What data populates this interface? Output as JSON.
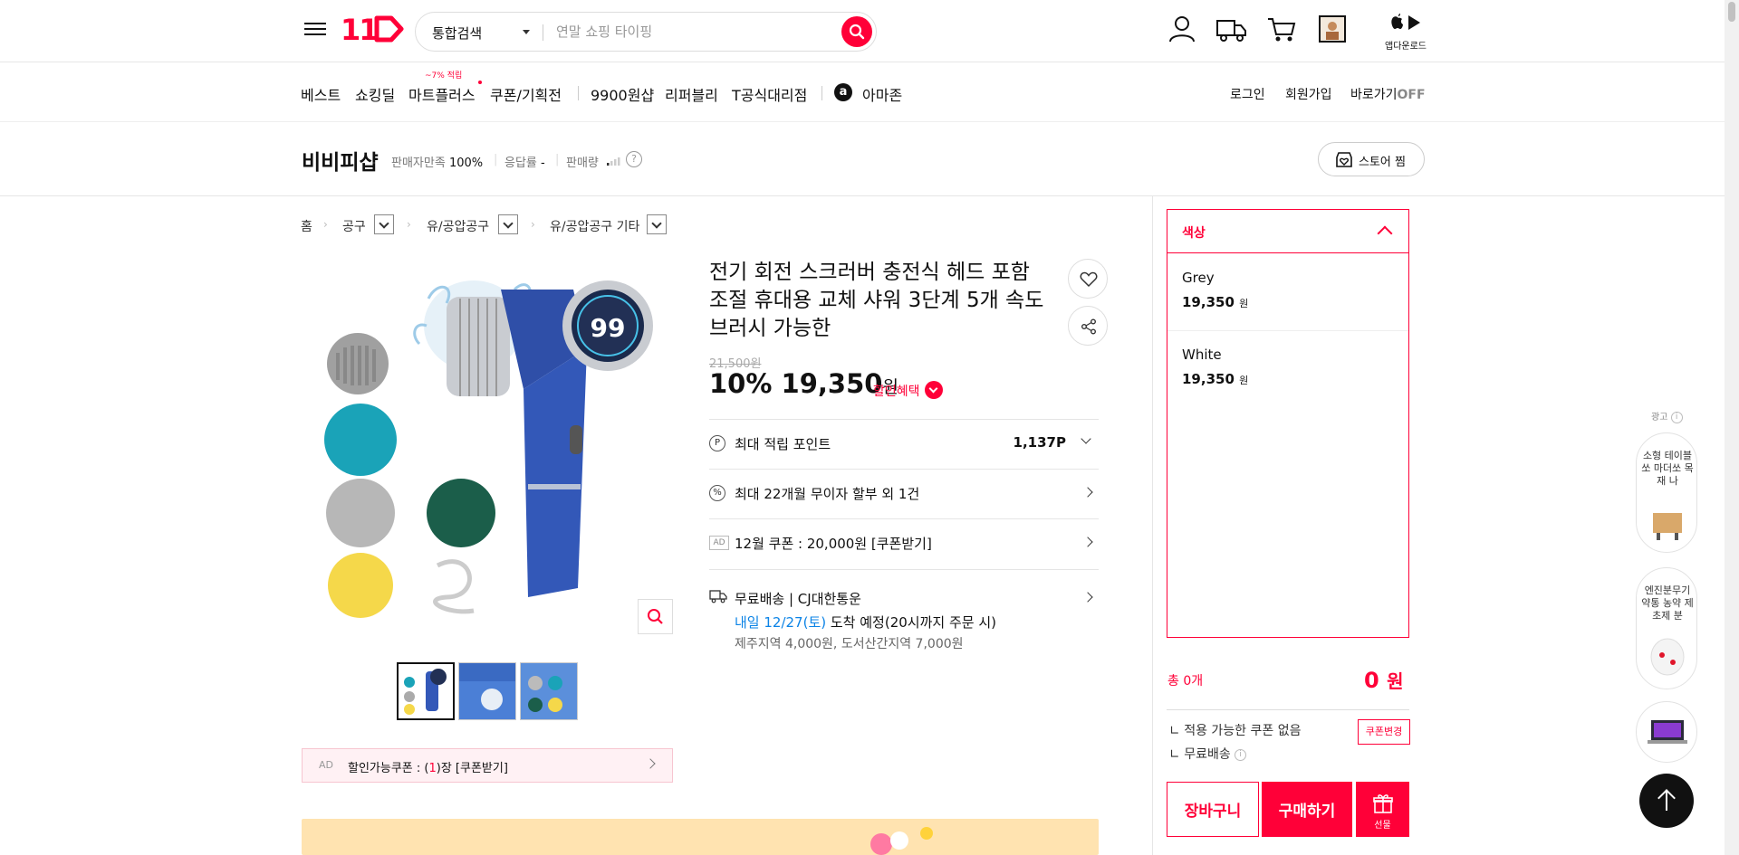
{
  "header": {
    "logo": "11",
    "search_scope": "통합검색",
    "search_placeholder": "연말 쇼핑 타이핑",
    "app_download": "앱다운로드"
  },
  "gnb": {
    "items": [
      "베스트",
      "쇼킹딜",
      "마트플러스",
      "쿠폰/기획전",
      "9900원샵",
      "리퍼블리",
      "T공식대리점",
      "아마존"
    ],
    "mart_badge": "~7% 적립",
    "util": {
      "login": "로그인",
      "join": "회원가입",
      "shortcut": "바로가기",
      "off": "OFF"
    }
  },
  "seller": {
    "name": "비비피샵",
    "satisfaction_label": "판매자만족",
    "satisfaction_value": "100%",
    "response_label": "응답률",
    "response_value": "-",
    "sales_label": "판매량",
    "store_button": "스토어 찜"
  },
  "breadcrumb": [
    "홈",
    "공구",
    "유/공압공구",
    "유/공압공구 기타"
  ],
  "product": {
    "title": "전기 회전 스크러버 충전식 헤드 포함 조절 휴대용 교체 샤워 3단계 5개 속도 브러시 가능한",
    "original_price": "21,500원",
    "discount": "10%",
    "price": "19,350",
    "won": "원",
    "discount_benefit": "할인혜택",
    "display_number": "99",
    "rows": [
      {
        "icon": "P",
        "label": "최대 적립 포인트",
        "value": "1,137P"
      },
      {
        "icon": "%",
        "label": "최대 22개월 무이자 할부 외 1건",
        "value": ""
      },
      {
        "icon": "AD",
        "label": "12월 쿠폰 : 20,000원 [쿠폰받기]",
        "value": ""
      }
    ],
    "shipping": {
      "line1": "무료배송 | CJ대한통운",
      "arrival_date": "내일 12/27(토)",
      "arrival_text": " 도착 예정",
      "arrival_cond": "(20시까지 주문 시)",
      "extra": "제주지역 4,000원, 도서산간지역 7,000원"
    },
    "coupon_bar": {
      "ad": "AD",
      "text_pre": "할인가능쿠폰 : (",
      "count": "1",
      "text_post": ")장 [쿠폰받기]"
    }
  },
  "options": {
    "header": "색상",
    "items": [
      {
        "name": "Grey",
        "price": "19,350",
        "unit": "원"
      },
      {
        "name": "White",
        "price": "19,350",
        "unit": "원"
      }
    ]
  },
  "order": {
    "total_label": "총 0개",
    "total_value": "0",
    "total_unit": "원",
    "coupon_none": "적용 가능한 쿠폰 없음",
    "coupon_change": "쿠폰변경",
    "free_shipping": "무료배송",
    "cart": "장바구니",
    "buy": "구매하기",
    "gift": "선물"
  },
  "side_ads": {
    "label": "광고",
    "cards": [
      "소형 테이블쏘 마더쏘 목재 나",
      "엔진분무기 약통 농약 제초제 분"
    ]
  },
  "colors": {
    "brand": "#ff0038",
    "blue": "#0b83e6"
  }
}
